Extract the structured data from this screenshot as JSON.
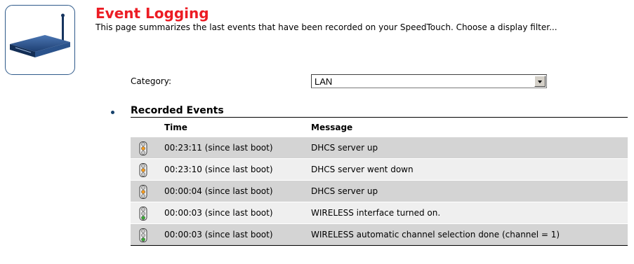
{
  "header": {
    "title": "Event Logging",
    "description": "This page summarizes the last events that have been recorded on your SpeedTouch. Choose a display filter..."
  },
  "filter": {
    "label": "Category:",
    "selected": "LAN"
  },
  "events": {
    "section_title": "Recorded Events",
    "columns": {
      "time": "Time",
      "message": "Message"
    },
    "rows": [
      {
        "time": "00:23:11 (since last boot)",
        "message": "DHCS server up",
        "severity": "orange"
      },
      {
        "time": "00:23:10 (since last boot)",
        "message": "DHCS server went down",
        "severity": "orange"
      },
      {
        "time": "00:00:04 (since last boot)",
        "message": "DHCS server up",
        "severity": "orange"
      },
      {
        "time": "00:00:03 (since last boot)",
        "message": "WIRELESS interface turned on.",
        "severity": "green"
      },
      {
        "time": "00:00:03 (since last boot)",
        "message": "WIRELESS automatic channel selection done (channel = 1)",
        "severity": "green"
      }
    ]
  },
  "icons": {
    "header": "router-icon",
    "dropdown": "dropdown-arrow-icon",
    "status": "traffic-light-icon"
  },
  "colors": {
    "title": "#ec1c24",
    "row_dark": "#d4d4d4",
    "row_light": "#efefef",
    "light_orange": "#f39a1e",
    "light_green": "#3aa935",
    "light_off": "#c8c8c8"
  }
}
